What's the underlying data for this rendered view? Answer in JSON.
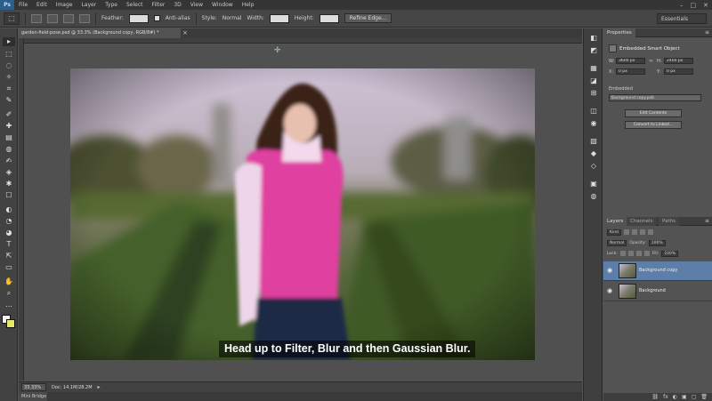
{
  "app": {
    "logo": "Ps"
  },
  "menu": [
    "File",
    "Edit",
    "Image",
    "Layer",
    "Type",
    "Select",
    "Filter",
    "3D",
    "View",
    "Window",
    "Help"
  ],
  "window_controls": [
    "–",
    "□",
    "✕"
  ],
  "options_bar": {
    "tool_glyph": "⬚",
    "feather_label": "Feather:",
    "feather_value": "0 px",
    "antialias_label": "Anti-alias",
    "style_label": "Style:",
    "style_value": "Normal",
    "width_label": "Width:",
    "height_label": "Height:",
    "refine_edge_label": "Refine Edge...",
    "workspace_label": "Essentials"
  },
  "document": {
    "tab_title": "garden-field-pose.psd @ 33.3% (Background copy, RGB/8#) *",
    "tab_close": "×",
    "zoom": "33.33%",
    "doc_info": "Doc: 14.1M/28.2M",
    "arrow": "▸",
    "minibridge_label": "Mini Bridge",
    "guide_marker": "✛"
  },
  "caption": "Head up to Filter, Blur and then Gaussian Blur.",
  "properties": {
    "tab": "Properties",
    "type_label": "Embedded Smart Object",
    "w_label": "W:",
    "w_value": "3600 px",
    "h_label": "H:",
    "h_value": "2400 px",
    "x_label": "X:",
    "x_value": "0 px",
    "y_label": "Y:",
    "y_value": "0 px",
    "link_icon": "∞",
    "section_label": "Embedded",
    "select_value": "Background copy.psb",
    "edit_button": "Edit Contents",
    "convert_button": "Convert to Linked..."
  },
  "layers": {
    "tabs": [
      "Layers",
      "Channels",
      "Paths"
    ],
    "kind_label": "Kind",
    "blend_mode": "Normal",
    "opacity_label": "Opacity:",
    "opacity_value": "100%",
    "lock_label": "Lock:",
    "fill_label": "Fill:",
    "fill_value": "100%",
    "eye_glyph": "◉",
    "items": [
      {
        "name": "Background copy"
      },
      {
        "name": "Background"
      }
    ],
    "footer_icons": [
      "⛓",
      "fx",
      "◐",
      "▣",
      "▢",
      "🗑"
    ]
  },
  "panel_menu_glyph": "≡",
  "tools": [
    "▸",
    "⬚",
    "◌",
    "✧",
    "⌗",
    "✎",
    "✐",
    "✚",
    "▤",
    "◍",
    "✍",
    "◈",
    "✱",
    "☐",
    "◐",
    "◔",
    "◕",
    "T",
    "⇱",
    "▭",
    "✋",
    "⌕",
    "…"
  ],
  "strip_icons": [
    "◧",
    "◩",
    "▦",
    "◪",
    "⊞",
    "◫",
    "◉",
    "▧",
    "◆",
    "◇",
    "▣",
    "◍"
  ]
}
